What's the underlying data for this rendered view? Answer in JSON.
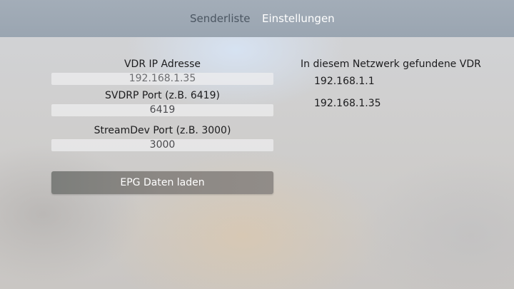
{
  "tabs": [
    {
      "label": "Senderliste",
      "selected": false
    },
    {
      "label": "Einstellungen",
      "selected": true
    }
  ],
  "settings": {
    "vdr_ip": {
      "label": "VDR IP Adresse",
      "value": "192.168.1.35"
    },
    "svdrp_port": {
      "label": "SVDRP Port (z.B. 6419)",
      "value": "6419"
    },
    "streamdev_port": {
      "label": "StreamDev Port (z.B. 3000)",
      "value": "3000"
    },
    "load_button": "EPG Daten laden"
  },
  "discovered": {
    "title": "In diesem Netzwerk gefundene VDR",
    "items": [
      "192.168.1.1",
      "192.168.1.35"
    ]
  }
}
